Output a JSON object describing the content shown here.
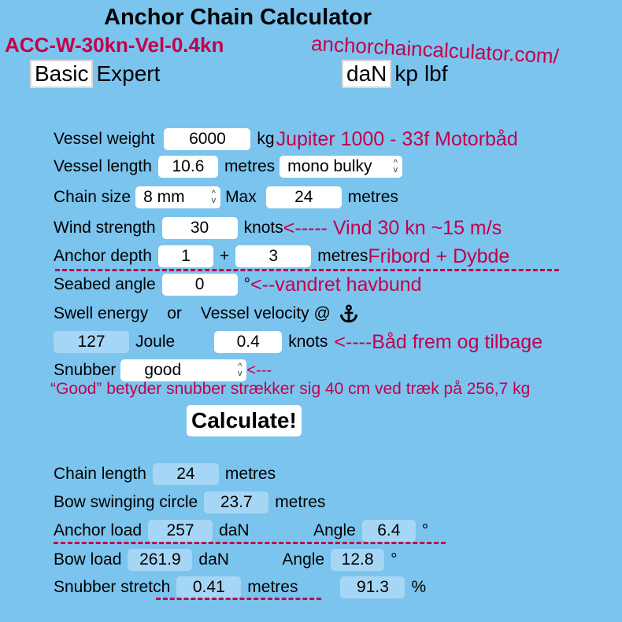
{
  "header": {
    "title": "Anchor Chain Calculator",
    "annotation_title": "ACC-W-30kn-Vel-0.4kn",
    "annotation_url": "anchorchaincalculator.com/"
  },
  "mode_tabs": [
    {
      "label": "Basic",
      "selected": true
    },
    {
      "label": "Expert",
      "selected": false
    }
  ],
  "unit_tabs": [
    {
      "label": "daN",
      "selected": true
    },
    {
      "label": "kp",
      "selected": false
    },
    {
      "label": "lbf",
      "selected": false
    }
  ],
  "inputs": {
    "vessel_weight": {
      "label": "Vessel weight",
      "value": "6000",
      "unit": "kg",
      "note": "Jupiter 1000 - 33f Motorbåd"
    },
    "vessel_length": {
      "label": "Vessel length",
      "value": "10.6",
      "unit": "metres",
      "type_select": "mono bulky"
    },
    "chain_size": {
      "label": "Chain size",
      "select": "8 mm",
      "max_label": "Max",
      "max_value": "24",
      "unit": "metres"
    },
    "wind_strength": {
      "label": "Wind strength",
      "value": "30",
      "unit": "knots",
      "note": "<----- Vind 30 kn  ~15 m/s"
    },
    "anchor_depth": {
      "label": "Anchor depth",
      "value1": "1",
      "plus": "+",
      "value2": "3",
      "unit": "metres",
      "note": "Fribord + Dybde"
    },
    "seabed_angle": {
      "label": "Seabed angle",
      "value": "0",
      "unit": "°",
      "note": "<--vandret havbund"
    },
    "swell": {
      "label": "Swell energy",
      "or": "or",
      "velocity_label": "Vessel velocity @",
      "icon": "anchor-icon"
    },
    "swell_values": {
      "energy": "127",
      "energy_unit": "Joule",
      "velocity": "0.4",
      "velocity_unit": "knots",
      "note": "<----Båd frem og tilbage"
    },
    "snubber": {
      "label": "Snubber",
      "select": "good",
      "note": "<---",
      "explanation": "“Good” betyder snubber strækker sig 40 cm ved træk på 256,7 kg"
    }
  },
  "calculate_label": "Calculate!",
  "results": {
    "chain_length": {
      "label": "Chain length",
      "value": "24",
      "unit": "metres"
    },
    "bow_swinging_circle": {
      "label": "Bow swinging circle",
      "value": "23.7",
      "unit": "metres"
    },
    "anchor_load": {
      "label": "Anchor load",
      "value": "257",
      "unit": "daN",
      "angle_label": "Angle",
      "angle": "6.4",
      "angle_unit": "°"
    },
    "bow_load": {
      "label": "Bow load",
      "value": "261.9",
      "unit": "daN",
      "angle_label": "Angle",
      "angle": "12.8",
      "angle_unit": "°"
    },
    "snubber_stretch": {
      "label": "Snubber stretch",
      "value": "0.41",
      "unit": "metres",
      "percent": "91.3",
      "percent_unit": "%"
    }
  },
  "colors": {
    "background": "#7bc4ee",
    "annotation": "#c4004a",
    "output_field": "#a6d6f5"
  }
}
